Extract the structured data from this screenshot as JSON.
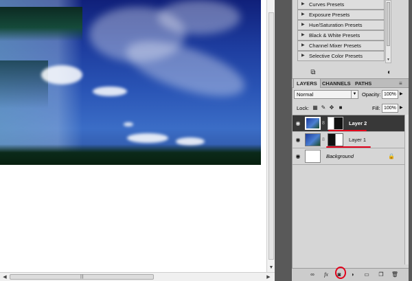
{
  "adjustments": {
    "presets": [
      "Curves Presets",
      "Exposure Presets",
      "Hue/Saturation Presets",
      "Black & White Presets",
      "Channel Mixer Presets",
      "Selective Color Presets"
    ],
    "icons": [
      "return-to-list-icon",
      "view-toggle-icon"
    ]
  },
  "layers_panel": {
    "tabs": [
      "LAYERS",
      "CHANNELS",
      "PATHS"
    ],
    "active_tab": "LAYERS",
    "blend_mode": "Normal",
    "opacity_label": "Opacity:",
    "opacity_value": "100%",
    "lock_label": "Lock:",
    "fill_label": "Fill:",
    "fill_value": "100%",
    "layers": [
      {
        "name": "Layer 2",
        "selected": true,
        "has_mask": true
      },
      {
        "name": "Layer 1",
        "selected": false,
        "has_mask": true
      },
      {
        "name": "Background",
        "selected": false,
        "locked": true
      }
    ],
    "footer_icons": [
      "link-layers-icon",
      "fx-icon",
      "add-mask-icon",
      "adjustment-layer-icon",
      "new-group-icon",
      "new-layer-icon",
      "delete-layer-icon"
    ]
  },
  "annotations": {
    "color": "#e2001a",
    "highlighted": [
      "Layer 2",
      "Layer 1",
      "add-mask-button"
    ]
  },
  "colors": {
    "panel_background": "#d6d6d6",
    "selected_layer": "#383838",
    "workspace": "#595959"
  }
}
